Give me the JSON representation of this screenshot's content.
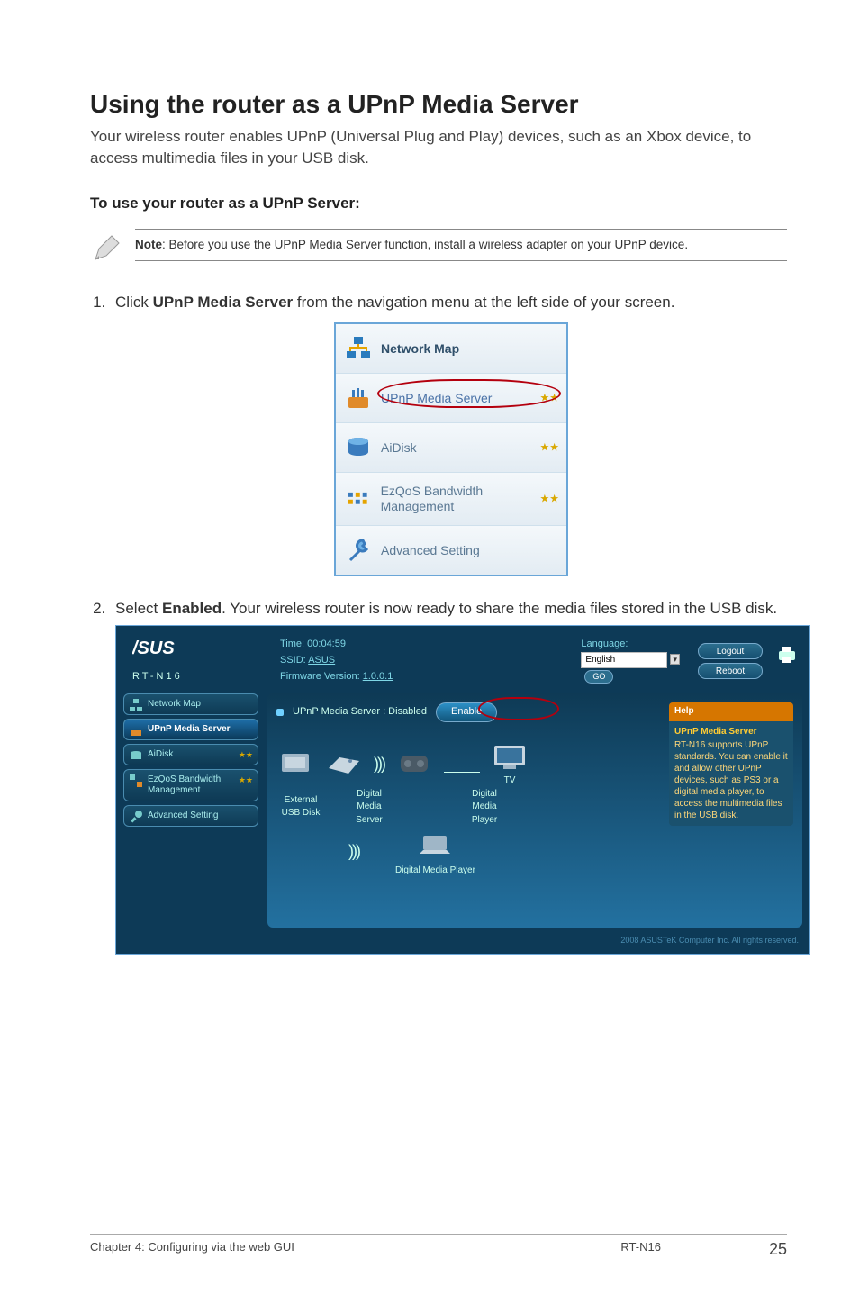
{
  "section": {
    "title": "Using the router as a UPnP Media Server",
    "intro": "Your wireless router enables UPnP (Universal Plug and Play) devices, such as an Xbox device, to access multimedia files in your USB disk.",
    "subheading": "To use your router as a UPnP Server:"
  },
  "note": {
    "prefix": "Note",
    "text": ": Before you use the UPnP Media Server function, install a wireless adapter on your UPnP device."
  },
  "steps": {
    "one_prefix": "Click ",
    "one_bold": "UPnP Media Server",
    "one_suffix": " from the navigation menu at the left side of your screen.",
    "two_prefix": "Select ",
    "two_bold": "Enabled",
    "two_suffix": ". Your wireless router is now ready to share the media files stored in the USB disk."
  },
  "nav_menu": {
    "items": [
      {
        "label": "Network Map"
      },
      {
        "label": "UPnP Media Server"
      },
      {
        "label": "AiDisk"
      },
      {
        "label": "EzQoS Bandwidth Management"
      },
      {
        "label": "Advanced Setting"
      }
    ]
  },
  "full_ui": {
    "model": "RT-N16",
    "time_label": "Time:",
    "time_value": "00:04:59",
    "ssid_label": "SSID:",
    "ssid_value": "ASUS",
    "fw_label": "Firmware Version:",
    "fw_value": "1.0.0.1",
    "lang_label": "Language:",
    "lang_value": "English",
    "go_label": "GO",
    "logout": "Logout",
    "reboot": "Reboot",
    "sidebar": [
      "Network Map",
      "UPnP Media Server",
      "AiDisk",
      "EzQoS Bandwidth Management",
      "Advanced Setting"
    ],
    "status_label": "UPnP Media Server : Disabled",
    "enable_label": "Enable",
    "devices": {
      "ext_usb": "External USB Disk",
      "dms": "Digital Media Server",
      "dmp_top": "Digital Media Player",
      "tv": "TV",
      "dmp_bottom": "Digital Media Player"
    },
    "help": {
      "title_bar": "Help",
      "heading": "UPnP Media Server",
      "body": "RT-N16 supports UPnP standards. You can enable it and allow other UPnP devices, such as PS3 or a digital media player, to access the multimedia files in the USB disk."
    },
    "copyright": "2008 ASUSTeK Computer Inc. All rights reserved."
  },
  "footer": {
    "left": "Chapter 4: Configuring via the web GUI",
    "mid": "RT-N16",
    "page": "25"
  }
}
